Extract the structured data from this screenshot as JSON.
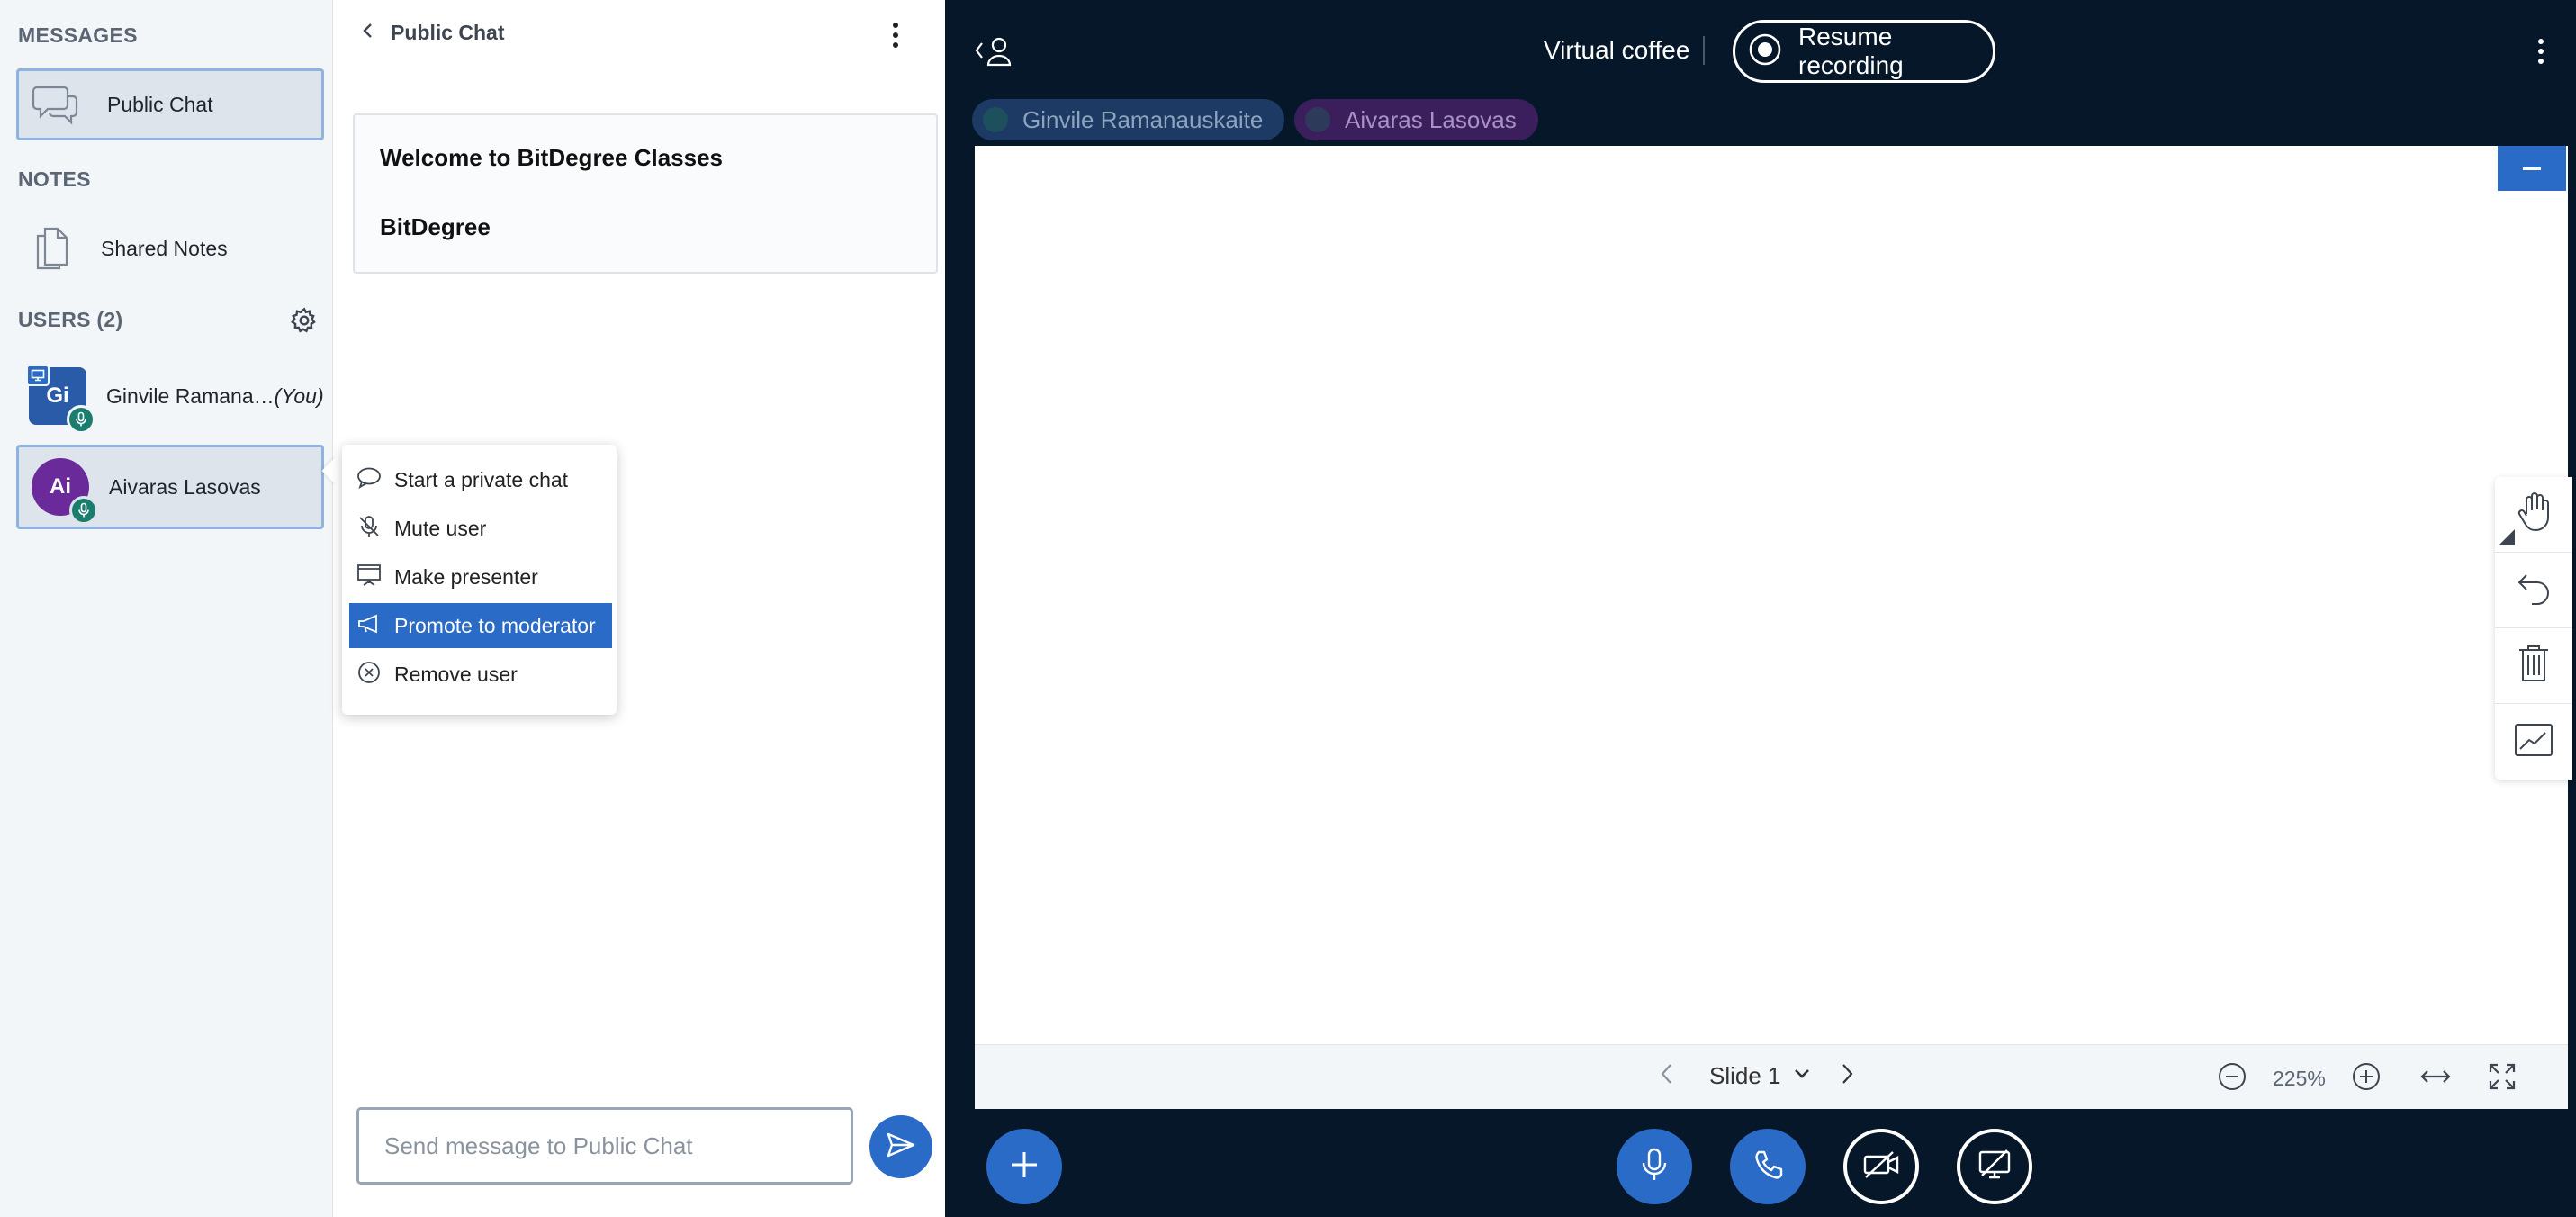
{
  "sidebar": {
    "messages_title": "MESSAGES",
    "public_chat_label": "Public Chat",
    "notes_title": "NOTES",
    "shared_notes_label": "Shared Notes",
    "users_title": "USERS (2)",
    "users": [
      {
        "initials": "Gi",
        "name": "Ginvile Ramana…",
        "suffix": "(You)",
        "color": "#2a5ba8"
      },
      {
        "initials": "Ai",
        "name": "Aivaras Lasovas",
        "suffix": "",
        "color": "#6a2a9a"
      }
    ]
  },
  "chat": {
    "title": "Public Chat",
    "welcome_line1": "Welcome to BitDegree Classes",
    "welcome_line2": "BitDegree",
    "input_placeholder": "Send message to Public Chat"
  },
  "context_menu": {
    "items": [
      {
        "label": "Start a private chat",
        "icon": "speech-bubble-icon"
      },
      {
        "label": "Mute user",
        "icon": "mic-off-icon"
      },
      {
        "label": "Make presenter",
        "icon": "presentation-icon"
      },
      {
        "label": "Promote to moderator",
        "icon": "megaphone-icon",
        "active": true
      },
      {
        "label": "Remove user",
        "icon": "remove-circle-icon"
      }
    ]
  },
  "stage": {
    "meeting_title": "Virtual coffee",
    "recording_label": "Resume recording",
    "talkers": [
      {
        "name": "Ginvile Ramanauskaite",
        "bg": "#1c3a63",
        "text": "#8ea3bd"
      },
      {
        "name": "Aivaras Lasovas",
        "bg": "#3b1f5c",
        "text": "#a891c4"
      }
    ],
    "slide_label": "Slide 1",
    "zoom_value": "225%"
  },
  "colors": {
    "accent": "#2a6bc7",
    "stage_bg": "#06172a",
    "mic_badge": "#1b7d6e"
  }
}
